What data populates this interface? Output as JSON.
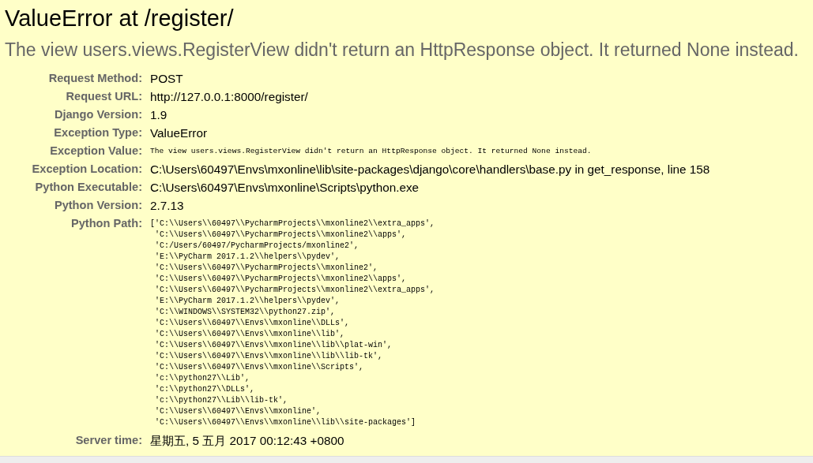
{
  "title": "ValueError at /register/",
  "subtitle": "The view users.views.RegisterView didn't return an HttpResponse object. It returned None instead.",
  "meta": [
    {
      "label": "Request Method:",
      "kind": "text",
      "value": "POST"
    },
    {
      "label": "Request URL:",
      "kind": "text",
      "value": "http://127.0.0.1:8000/register/"
    },
    {
      "label": "Django Version:",
      "kind": "text",
      "value": "1.9"
    },
    {
      "label": "Exception Type:",
      "kind": "text",
      "value": "ValueError"
    },
    {
      "label": "Exception Value:",
      "kind": "code",
      "value": "The view users.views.RegisterView didn't return an HttpResponse object. It returned None instead."
    },
    {
      "label": "Exception Location:",
      "kind": "text",
      "value": "C:\\Users\\60497\\Envs\\mxonline\\lib\\site-packages\\django\\core\\handlers\\base.py in get_response, line 158"
    },
    {
      "label": "Python Executable:",
      "kind": "text",
      "value": "C:\\Users\\60497\\Envs\\mxonline\\Scripts\\python.exe"
    },
    {
      "label": "Python Version:",
      "kind": "text",
      "value": "2.7.13"
    },
    {
      "label": "Python Path:",
      "kind": "lines",
      "lines": [
        "['C:\\\\Users\\\\60497\\\\PycharmProjects\\\\mxonline2\\\\extra_apps',",
        " 'C:\\\\Users\\\\60497\\\\PycharmProjects\\\\mxonline2\\\\apps',",
        " 'C:/Users/60497/PycharmProjects/mxonline2',",
        " 'E:\\\\PyCharm 2017.1.2\\\\helpers\\\\pydev',",
        " 'C:\\\\Users\\\\60497\\\\PycharmProjects\\\\mxonline2',",
        " 'C:\\\\Users\\\\60497\\\\PycharmProjects\\\\mxonline2\\\\apps',",
        " 'C:\\\\Users\\\\60497\\\\PycharmProjects\\\\mxonline2\\\\extra_apps',",
        " 'E:\\\\PyCharm 2017.1.2\\\\helpers\\\\pydev',",
        " 'C:\\\\WINDOWS\\\\SYSTEM32\\\\python27.zip',",
        " 'C:\\\\Users\\\\60497\\\\Envs\\\\mxonline\\\\DLLs',",
        " 'C:\\\\Users\\\\60497\\\\Envs\\\\mxonline\\\\lib',",
        " 'C:\\\\Users\\\\60497\\\\Envs\\\\mxonline\\\\lib\\\\plat-win',",
        " 'C:\\\\Users\\\\60497\\\\Envs\\\\mxonline\\\\lib\\\\lib-tk',",
        " 'C:\\\\Users\\\\60497\\\\Envs\\\\mxonline\\\\Scripts',",
        " 'c:\\\\python27\\\\Lib',",
        " 'c:\\\\python27\\\\DLLs',",
        " 'c:\\\\python27\\\\Lib\\\\lib-tk',",
        " 'C:\\\\Users\\\\60497\\\\Envs\\\\mxonline',",
        " 'C:\\\\Users\\\\60497\\\\Envs\\\\mxonline\\\\lib\\\\site-packages']"
      ]
    },
    {
      "label": "Server time:",
      "kind": "text",
      "value": "星期五, 5 五月 2017 00:12:43 +0800"
    }
  ]
}
